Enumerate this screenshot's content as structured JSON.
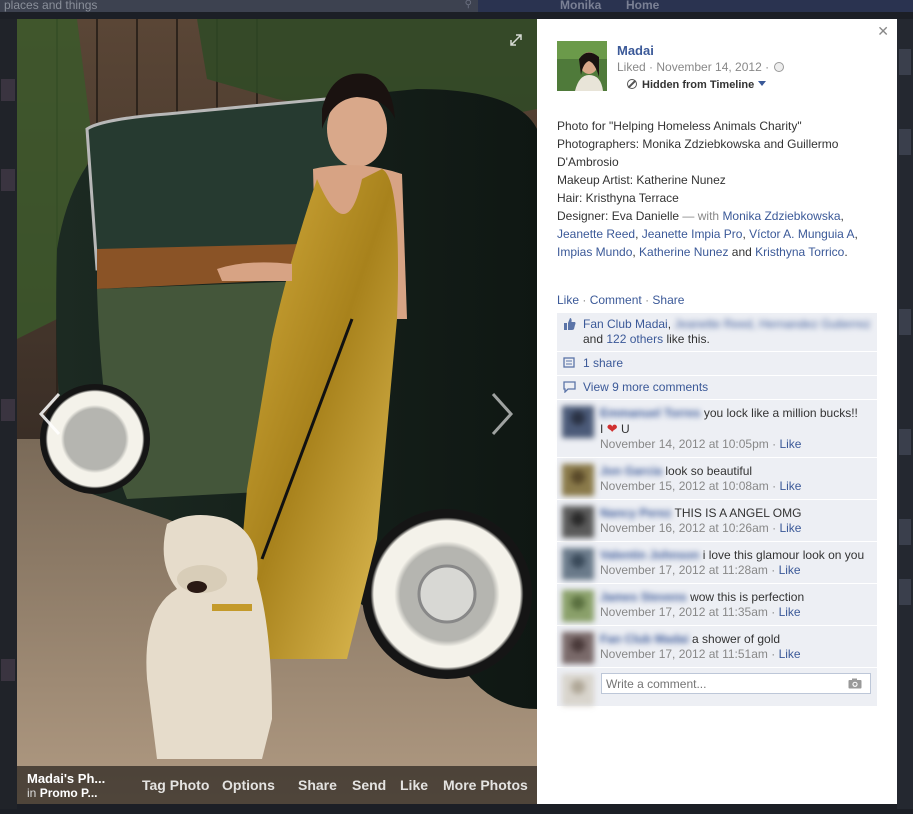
{
  "background": {
    "search_placeholder": "places and things",
    "nav_profile": "Monika",
    "nav_home": "Home"
  },
  "photo_bar": {
    "album_title": "Madai's Ph...",
    "album_in_prefix": "in",
    "album_name": "Promo P...",
    "tag_photo": "Tag Photo",
    "options": "Options",
    "share": "Share",
    "send": "Send",
    "like": "Like",
    "more_photos": "More Photos"
  },
  "panel": {
    "owner_name": "Madai",
    "meta": "Liked · November 14, 2012 ·",
    "hidden_label": "Hidden from Timeline",
    "caption_lines": [
      "Photo for \"Helping Homeless Animals Charity\"",
      "Photographers: Monika Zdziebkowska and Guillermo D'Ambrosio",
      "Makeup Artist: Katherine Nunez",
      "Hair: Kristhyna Terrace",
      "Designer: Eva Danielle"
    ],
    "with_prefix": "— with",
    "tags": [
      "Monika Zdziebkowska",
      "Jeanette Reed",
      "Jeanette Impia Pro",
      "Víctor A. Munguia A",
      "Impias Mundo",
      "Katherine Nunez",
      "Kristhyna Torrico"
    ],
    "and_word": "and",
    "actions": {
      "like": "Like",
      "comment": "Comment",
      "share": "Share",
      "sep": "·"
    },
    "likes": {
      "first": "Fan Club Madai",
      "blurred": "Jeanette Reed, Hernandez Gutierrez",
      "and_word": "and",
      "others": "122 others",
      "suffix": "like this."
    },
    "shares": "1 share",
    "view_more": "View 9 more comments",
    "comments": [
      {
        "author": "Emmanuel Torres",
        "text": "you lock like a million bucks!!",
        "text2": "I",
        "text3": "U",
        "time": "November 14, 2012 at 10:05pm",
        "like": "Like",
        "sep": "·"
      },
      {
        "author": "Jon Garcia",
        "text": "look so beautiful",
        "time": "November 15, 2012 at 10:08am",
        "like": "Like",
        "sep": "·"
      },
      {
        "author": "Nancy Perez",
        "text": "THIS IS A ANGEL OMG",
        "time": "November 16, 2012 at 10:26am",
        "like": "Like",
        "sep": "·"
      },
      {
        "author": "Valentin Johnson",
        "text": "i love this glamour look on you",
        "time": "November 17, 2012 at 11:28am",
        "like": "Like",
        "sep": "·"
      },
      {
        "author": "James Stevens",
        "text": "wow this is perfection",
        "time": "November 17, 2012 at 11:35am",
        "like": "Like",
        "sep": "·"
      },
      {
        "author": "Fan Club Madai",
        "text": "a shower of gold",
        "time": "November 17, 2012 at 11:51am",
        "like": "Like",
        "sep": "·"
      }
    ],
    "write_placeholder": "Write a comment..."
  },
  "colors": {
    "link": "#3b5998",
    "ufi_bg": "#edeff4"
  }
}
